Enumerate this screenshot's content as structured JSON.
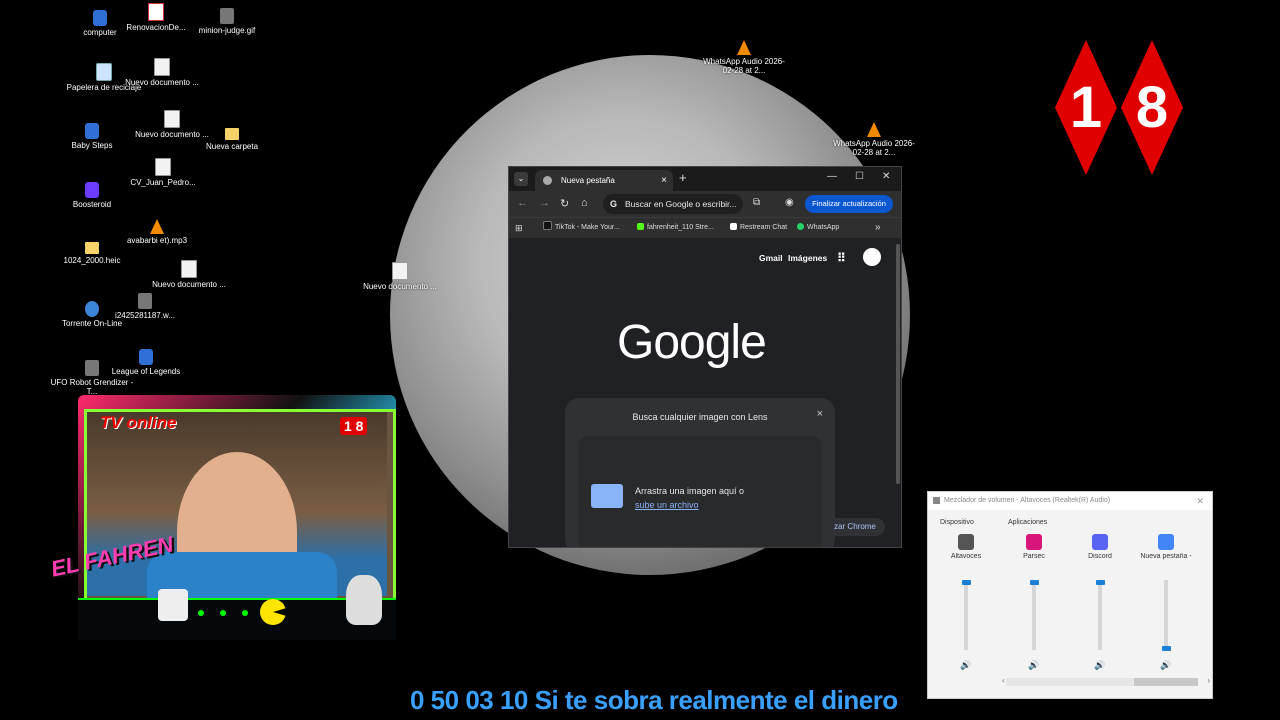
{
  "desktop": {
    "icons": [
      {
        "label": "computer",
        "kind": "blue"
      },
      {
        "label": "RenovacionDe...",
        "kind": "pdf"
      },
      {
        "label": "minion-judge.gif",
        "kind": "gray"
      },
      {
        "label": "Papelera de reciclaje",
        "kind": "bin"
      },
      {
        "label": "Nuevo documento ...",
        "kind": "file"
      },
      {
        "label": "Baby Steps",
        "kind": "blue"
      },
      {
        "label": "Nuevo documento ...",
        "kind": "file"
      },
      {
        "label": "Nueva carpeta",
        "kind": "folder"
      },
      {
        "label": "CV_Juan_Pedro...",
        "kind": "file"
      },
      {
        "label": "Boosteroid",
        "kind": "purple"
      },
      {
        "label": "avabarbi et).mp3",
        "kind": "cone"
      },
      {
        "label": "1024_2000.heic",
        "kind": "folder"
      },
      {
        "label": "Nuevo documento ...",
        "kind": "file"
      },
      {
        "label": "Torrente On-Line",
        "kind": "round"
      },
      {
        "label": "i2425281187.w...",
        "kind": "gray"
      },
      {
        "label": "UFO Robot Grendizer - T...",
        "kind": "gray"
      },
      {
        "label": "League of Legends",
        "kind": "blue"
      },
      {
        "label": "Nuevo documento ...",
        "kind": "file"
      },
      {
        "label": "WhatsApp Audio 2026-02-28 at 2...",
        "kind": "cone"
      },
      {
        "label": "WhatsApp Audio 2026-02-28 at 2...",
        "kind": "cone"
      }
    ]
  },
  "badge": {
    "digit1": "1",
    "digit2": "8"
  },
  "chrome": {
    "tab_title": "Nueva pestaña",
    "tab_close": "×",
    "new_tab": "+",
    "tab_list": "⌄",
    "minimize": "—",
    "maximize": "☐",
    "close": "✕",
    "back": "←",
    "forward": "→",
    "reload": "↻",
    "home": "⌂",
    "omnibox_placeholder": "Buscar en Google o escribir...",
    "update_button": "Finalizar actualización",
    "bookmarks": [
      {
        "label": "TikTok - Make Your...",
        "color": "#111111"
      },
      {
        "label": "fahrenheit_110 Stre...",
        "color": "#53fc18"
      },
      {
        "label": "Restream Chat",
        "color": "#ffffff"
      },
      {
        "label": "WhatsApp",
        "color": "#25d366"
      }
    ],
    "more_bookmarks": "»",
    "gmail": "Gmail",
    "images": "Imágenes",
    "logo": "Google",
    "lens_title": "Busca cualquier imagen con Lens",
    "lens_close": "×",
    "drop_text": "Arrastra una imagen aquí o",
    "upload_link": "sube un archivo",
    "customize_button": "zar Chrome"
  },
  "webcam": {
    "overlay_text": "TV online",
    "badge": "1 8",
    "brand": "EL FAHREN"
  },
  "mixer": {
    "title": "Mezclador de volumen - Altavoces (Realtek(R) Audio)",
    "close": "✕",
    "section_device": "Dispositivo",
    "section_apps": "Aplicaciones",
    "channels": [
      {
        "name": "Altavoces",
        "level": 1.0,
        "color": "#555555"
      },
      {
        "name": "Parsec",
        "level": 1.0,
        "color": "#d8157a"
      },
      {
        "name": "Discord",
        "level": 1.0,
        "color": "#5865f2"
      },
      {
        "name": "Nueva pestaña -",
        "level": 0.0,
        "color": "#4285f4"
      }
    ],
    "speaker_glyph": "🔊",
    "left_arrow": "‹",
    "right_arrow": "›"
  },
  "ticker": {
    "text": "0 50 03 10 Si te sobra realmente el dinero"
  }
}
